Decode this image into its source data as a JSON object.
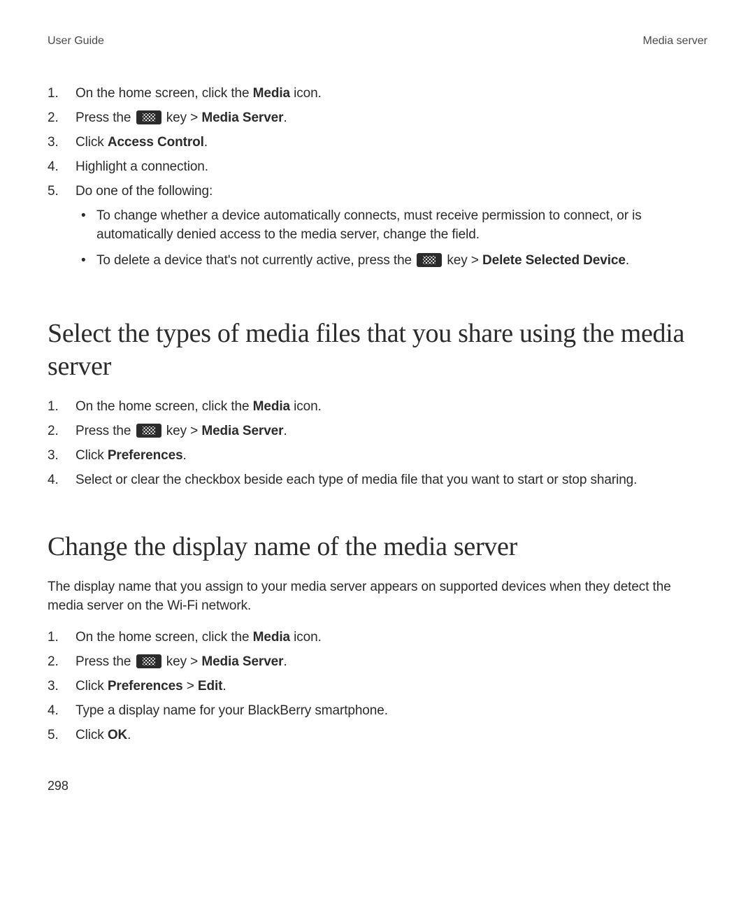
{
  "header": {
    "left": "User Guide",
    "right": "Media server"
  },
  "section0": {
    "steps": [
      {
        "num": "1.",
        "segments": [
          {
            "t": "On the home screen, click the "
          },
          {
            "t": "Media",
            "b": true
          },
          {
            "t": " icon."
          }
        ]
      },
      {
        "num": "2.",
        "segments": [
          {
            "t": "Press the "
          },
          {
            "icon": "menu"
          },
          {
            "t": " key > "
          },
          {
            "t": "Media Server",
            "b": true
          },
          {
            "t": "."
          }
        ]
      },
      {
        "num": "3.",
        "segments": [
          {
            "t": "Click "
          },
          {
            "t": "Access Control",
            "b": true
          },
          {
            "t": "."
          }
        ]
      },
      {
        "num": "4.",
        "segments": [
          {
            "t": "Highlight a connection."
          }
        ]
      },
      {
        "num": "5.",
        "segments": [
          {
            "t": "Do one of the following:"
          }
        ],
        "bullets": [
          [
            {
              "t": "To change whether a device automatically connects, must receive permission to connect, or is automatically denied access to the media server, change the field."
            }
          ],
          [
            {
              "t": "To delete a device that's not currently active, press the "
            },
            {
              "icon": "menu"
            },
            {
              "t": " key > "
            },
            {
              "t": "Delete Selected Device",
              "b": true
            },
            {
              "t": "."
            }
          ]
        ]
      }
    ]
  },
  "section1": {
    "heading": "Select the types of media files that you share using the media server",
    "steps": [
      {
        "num": "1.",
        "segments": [
          {
            "t": "On the home screen, click the "
          },
          {
            "t": "Media",
            "b": true
          },
          {
            "t": " icon."
          }
        ]
      },
      {
        "num": "2.",
        "segments": [
          {
            "t": "Press the "
          },
          {
            "icon": "menu"
          },
          {
            "t": " key > "
          },
          {
            "t": "Media Server",
            "b": true
          },
          {
            "t": "."
          }
        ]
      },
      {
        "num": "3.",
        "segments": [
          {
            "t": "Click "
          },
          {
            "t": "Preferences",
            "b": true
          },
          {
            "t": "."
          }
        ]
      },
      {
        "num": "4.",
        "segments": [
          {
            "t": "Select or clear the checkbox beside each type of media file that you want to start or stop sharing."
          }
        ]
      }
    ]
  },
  "section2": {
    "heading": "Change the display name of the media server",
    "intro": "The display name that you assign to your media server appears on supported devices when they detect the media server on the Wi-Fi network.",
    "steps": [
      {
        "num": "1.",
        "segments": [
          {
            "t": "On the home screen, click the "
          },
          {
            "t": "Media",
            "b": true
          },
          {
            "t": " icon."
          }
        ]
      },
      {
        "num": "2.",
        "segments": [
          {
            "t": "Press the "
          },
          {
            "icon": "menu"
          },
          {
            "t": " key > "
          },
          {
            "t": "Media Server",
            "b": true
          },
          {
            "t": "."
          }
        ]
      },
      {
        "num": "3.",
        "segments": [
          {
            "t": "Click "
          },
          {
            "t": "Preferences",
            "b": true
          },
          {
            "t": " > "
          },
          {
            "t": "Edit",
            "b": true
          },
          {
            "t": "."
          }
        ]
      },
      {
        "num": "4.",
        "segments": [
          {
            "t": "Type a display name for your BlackBerry smartphone."
          }
        ]
      },
      {
        "num": "5.",
        "segments": [
          {
            "t": "Click "
          },
          {
            "t": "OK",
            "b": true
          },
          {
            "t": "."
          }
        ]
      }
    ]
  },
  "pageNumber": "298"
}
